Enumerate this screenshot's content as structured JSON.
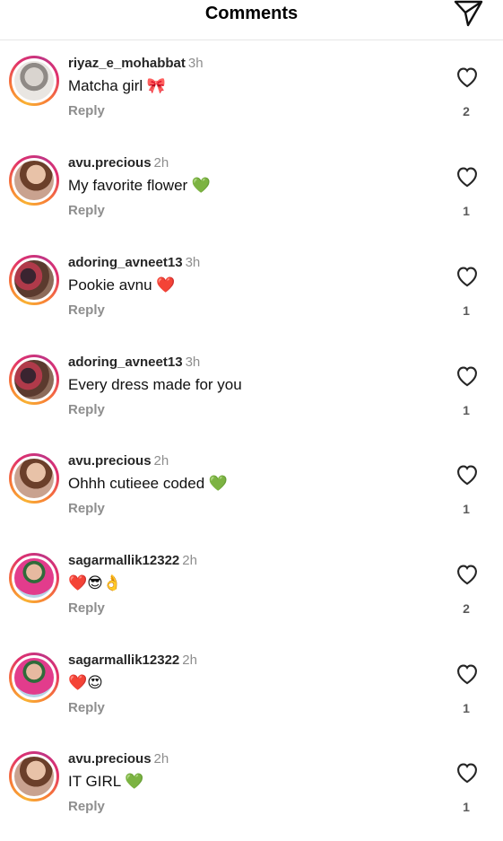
{
  "header": {
    "title": "Comments",
    "send_icon": "send-icon"
  },
  "comments": [
    {
      "username": "riyaz_e_mohabbat",
      "time": "3h",
      "text": "Matcha girl 🎀",
      "reply": "Reply",
      "likes": "2",
      "avatar": "riyaz"
    },
    {
      "username": "avu.precious",
      "time": "2h",
      "text": "My favorite flower 💚",
      "reply": "Reply",
      "likes": "1",
      "avatar": "avu"
    },
    {
      "username": "adoring_avneet13",
      "time": "3h",
      "text": "Pookie avnu ❤️",
      "reply": "Reply",
      "likes": "1",
      "avatar": "adoring"
    },
    {
      "username": "adoring_avneet13",
      "time": "3h",
      "text": "Every dress made for you",
      "reply": "Reply",
      "likes": "1",
      "avatar": "adoring"
    },
    {
      "username": "avu.precious",
      "time": "2h",
      "text": "Ohhh cutieee coded 💚",
      "reply": "Reply",
      "likes": "1",
      "avatar": "avu"
    },
    {
      "username": "sagarmallik12322",
      "time": "2h",
      "text": "❤️😎👌",
      "reply": "Reply",
      "likes": "2",
      "avatar": "sagar"
    },
    {
      "username": "sagarmallik12322",
      "time": "2h",
      "text": "❤️😍",
      "reply": "Reply",
      "likes": "1",
      "avatar": "sagar"
    },
    {
      "username": "avu.precious",
      "time": "2h",
      "text": "IT GIRL 💚",
      "reply": "Reply",
      "likes": "1",
      "avatar": "avu"
    }
  ]
}
